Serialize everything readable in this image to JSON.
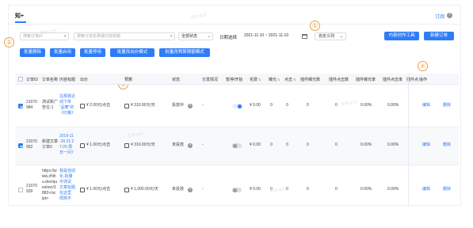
{
  "tab": {
    "active": "知+"
  },
  "top_right": {
    "link": "订阅",
    "help": "?"
  },
  "filters": {
    "order_placeholder": "搜索订单id",
    "content_placeholder": "搜索订单名称或内容标题",
    "status_select": "全部状态",
    "date_label": "日期选择",
    "date_range": "2021-11-10 ~ 2021-11-10",
    "custom_columns": "自定义列",
    "tool_button": "内容创作工具",
    "new_order_button": "新建订单"
  },
  "batch_actions": [
    "批量删除",
    "批量启用",
    "批量停用",
    "批量改出价模式",
    "批量改预算限额模式"
  ],
  "annotations": [
    "①",
    "②",
    "③",
    "④"
  ],
  "table": {
    "headers": {
      "order_id": "订单ID",
      "order_name": "订单名称",
      "content_title": "内容标题",
      "bid": "出价",
      "budget": "预算",
      "status": "状态",
      "delivery": "分发情况",
      "pause": "暂停/开始",
      "spend": "花费",
      "impressions": "曝光",
      "clicks": "点击",
      "plugin_impr": "插件曝光数",
      "plugin_clicks": "插件点击数",
      "plugin_impr_rate": "插件曝光率",
      "plugin_ctr": "插件点击率",
      "plugin_ops": "插件点",
      "ops": "操作"
    },
    "rows": [
      {
        "id_lines": [
          "21070",
          "984"
        ],
        "name_lines": [
          "测试新广",
          "告位-1"
        ],
        "title_lines": [
          "在那靠近",
          "动下单",
          "“品奢”的",
          "《印量》"
        ],
        "bid": "¥ 2.00元/点击",
        "budget": "¥ 310.00元/天",
        "status": "投放中",
        "delivery": "-",
        "switch_on": true,
        "spend": "¥ 0.00",
        "impressions": "0",
        "clicks": "0",
        "plugin_impr": "0",
        "plugin_clicks": "0",
        "plugin_impr_rate": "0.00%",
        "plugin_ctr": "0.00%",
        "edit": "编辑",
        "delete": "删除"
      },
      {
        "id_lines": [
          "21070",
          "952"
        ],
        "name_lines": [
          "新建文章",
          "订单0"
        ],
        "title_lines": [
          "2019-11",
          "-26 21:2",
          "7:25 周",
          "日一问7"
        ],
        "bid": "¥ 1.00元/点击",
        "budget": "¥ 310.00元/天",
        "status": "未投放",
        "delivery": "-",
        "switch_on": false,
        "spend": "¥ 0.00",
        "impressions": "0",
        "clicks": "0",
        "plugin_impr": "0",
        "plugin_clicks": "0",
        "plugin_impr_rate": "0.00%",
        "plugin_ctr": "0.00%",
        "edit": "编辑",
        "delete": "删除"
      },
      {
        "id_lines": [
          "21070",
          "939"
        ],
        "name_lines": [
          "https://w",
          "ww.zhih",
          "u.dev/qu",
          "estion/3",
          "882</sc",
          "ipt>"
        ],
        "title_lines": [
          "我是自动",
          "化-批量",
          "中测试",
          "文章标题",
          "在这里",
          "样刚不"
        ],
        "bid": "¥ 1.00元/点击",
        "budget": "¥ 1,000.00元/天",
        "status": "未投放",
        "delivery": "-",
        "switch_on": false,
        "spend": "¥ 0.00",
        "impressions": "0",
        "clicks": "0",
        "plugin_impr": "0",
        "plugin_clicks": "0",
        "plugin_impr_rate": "0.00%",
        "plugin_ctr": "0.00%",
        "edit": "编辑",
        "delete": "删除"
      }
    ]
  },
  "watermarks": [
    "知乎水印",
    "知乎水印",
    "知乎水印",
    "知乎水印",
    "知乎水印",
    "知乎水印"
  ],
  "colors": {
    "accent": "#2f7cf6",
    "annotation": "#e7a14a"
  }
}
